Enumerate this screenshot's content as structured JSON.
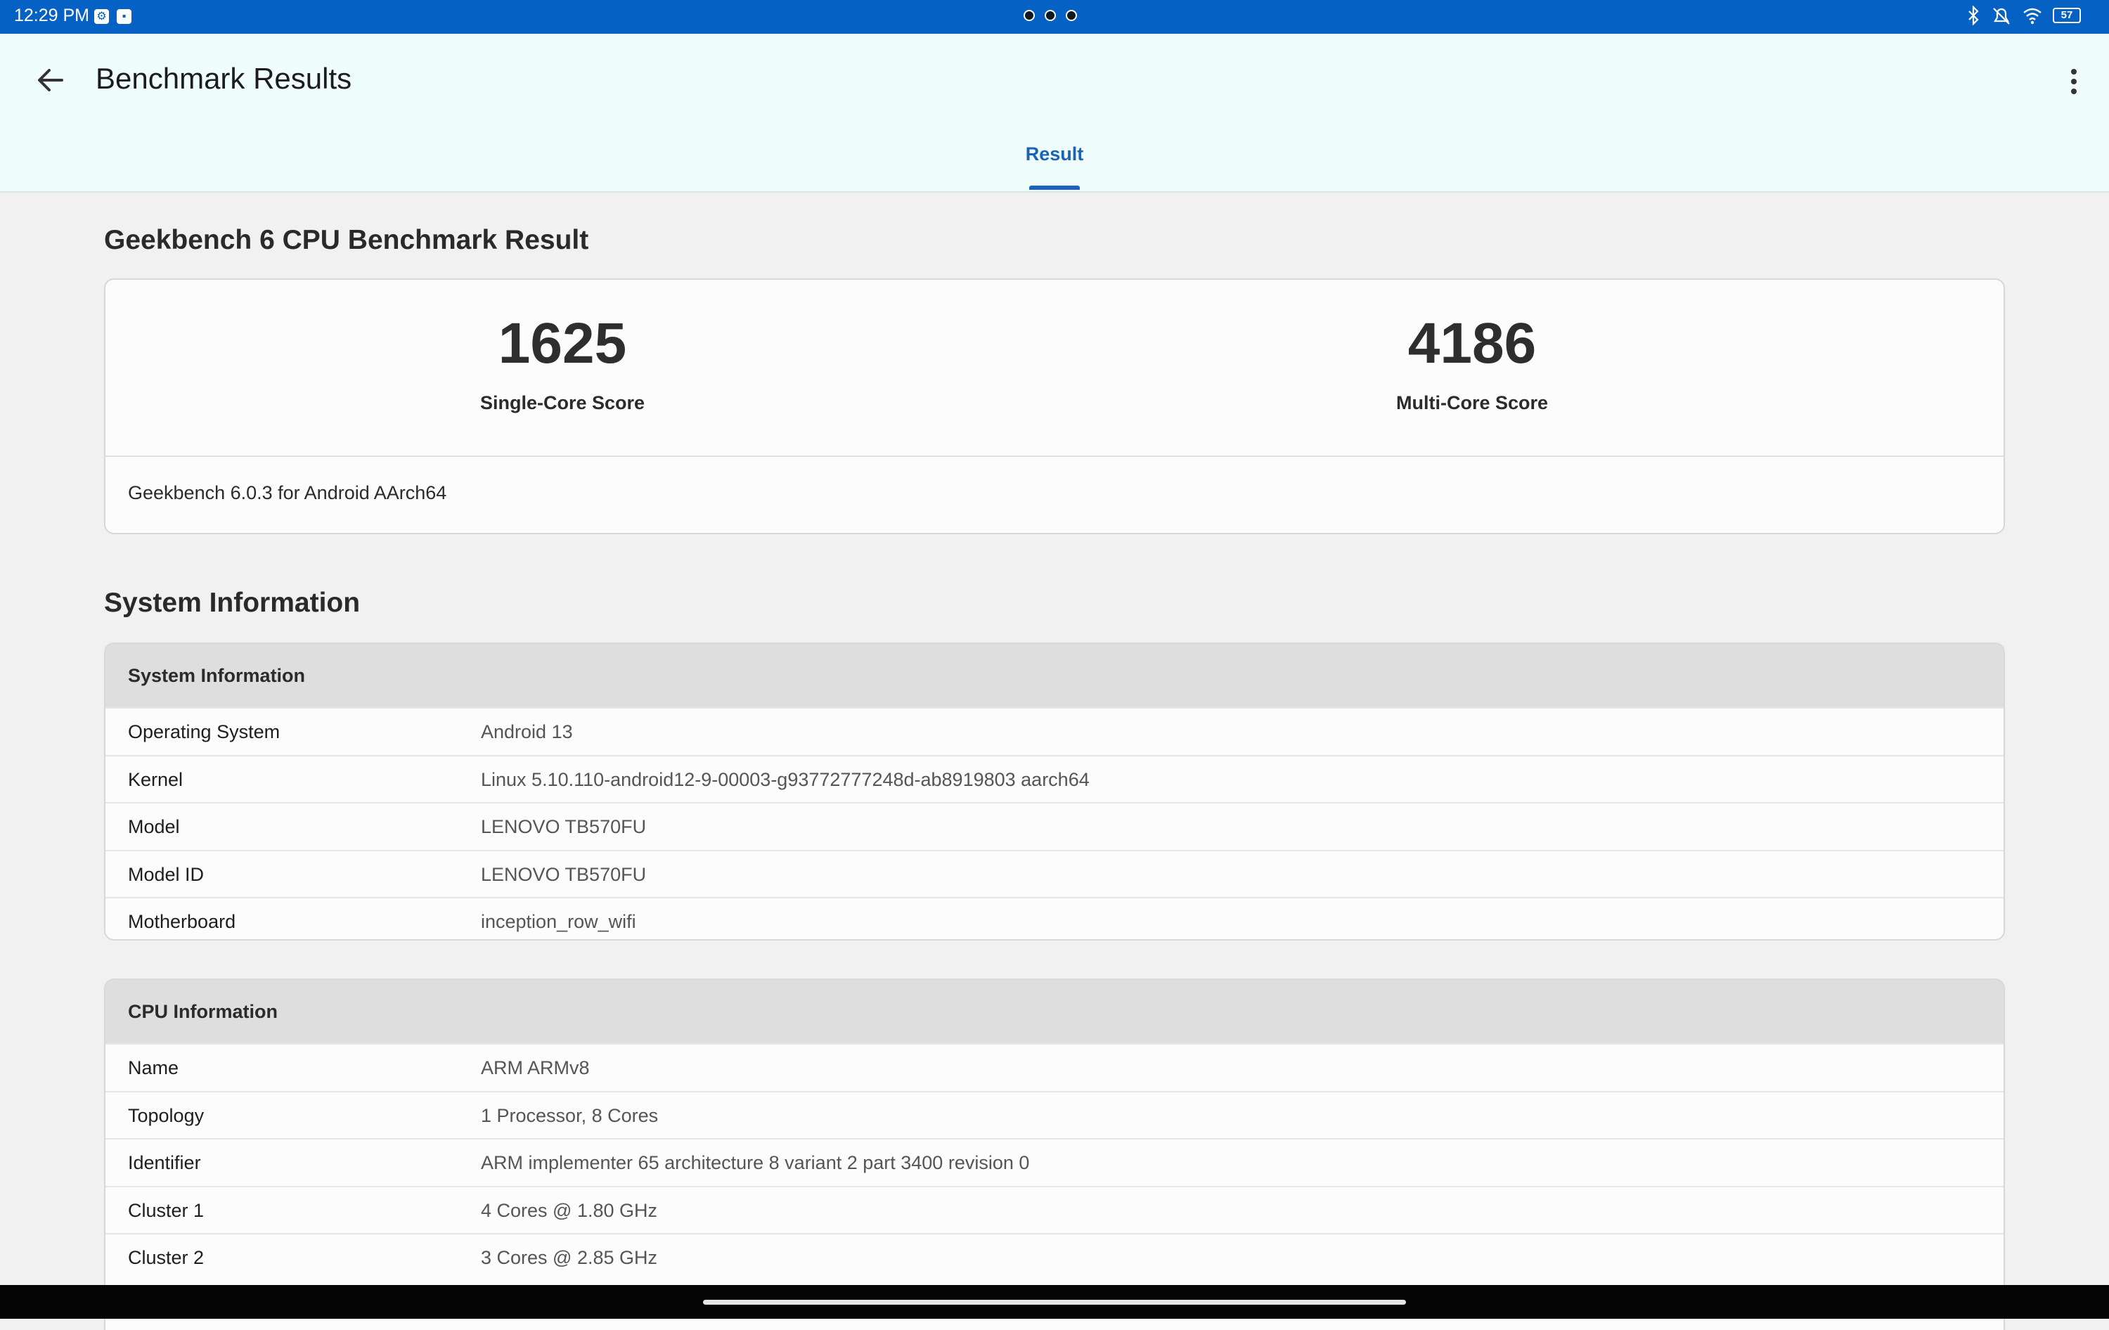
{
  "status_bar": {
    "time": "12:29 PM",
    "app_icons": [
      "settings-app-icon",
      "geekbench-app-icon"
    ],
    "battery": "57"
  },
  "app_bar": {
    "title": "Benchmark Results",
    "tabs": [
      {
        "label": "Result",
        "selected": true
      }
    ]
  },
  "result": {
    "section_title": "Geekbench 6 CPU Benchmark Result",
    "single_core": {
      "value": "1625",
      "label": "Single-Core Score"
    },
    "multi_core": {
      "value": "4186",
      "label": "Multi-Core Score"
    },
    "version": "Geekbench 6.0.3 for Android AArch64"
  },
  "system_information": {
    "section_title": "System Information",
    "card_title": "System Information",
    "rows": [
      {
        "key": "Operating System",
        "value": "Android 13"
      },
      {
        "key": "Kernel",
        "value": "Linux 5.10.110-android12-9-00003-g93772777248d-ab8919803 aarch64"
      },
      {
        "key": "Model",
        "value": "LENOVO TB570FU"
      },
      {
        "key": "Model ID",
        "value": "LENOVO TB570FU"
      },
      {
        "key": "Motherboard",
        "value": "inception_row_wifi"
      }
    ]
  },
  "cpu_information": {
    "card_title": "CPU Information",
    "rows": [
      {
        "key": "Name",
        "value": "ARM ARMv8"
      },
      {
        "key": "Topology",
        "value": "1 Processor, 8 Cores"
      },
      {
        "key": "Identifier",
        "value": "ARM implementer 65 architecture 8 variant 2 part 3400 revision 0"
      },
      {
        "key": "Cluster 1",
        "value": "4 Cores @ 1.80 GHz"
      },
      {
        "key": "Cluster 2",
        "value": "3 Cores @ 2.85 GHz"
      }
    ]
  },
  "colors": {
    "status_bar": "#0562c4",
    "app_bar": "#effdfd",
    "accent": "#1a63b6",
    "background": "#f1f1f1"
  }
}
